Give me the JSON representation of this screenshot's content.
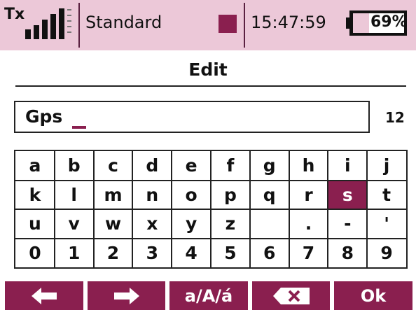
{
  "status_bar": {
    "tx_label": "Tx",
    "signal_icon": "signal-bars-icon",
    "model_name": "Standard",
    "record_indicator_color": "#8a1f4f",
    "clock": "15:47:59",
    "battery_percent": "69%",
    "battery_level": 0.69,
    "background_color": "#ecc8d8"
  },
  "screen": {
    "title": "Edit"
  },
  "text_input": {
    "value": "Gps",
    "remaining_chars": "12"
  },
  "keyboard": {
    "rows": [
      [
        "a",
        "b",
        "c",
        "d",
        "e",
        "f",
        "g",
        "h",
        "i",
        "j"
      ],
      [
        "k",
        "l",
        "m",
        "n",
        "o",
        "p",
        "q",
        "r",
        "s",
        "t"
      ],
      [
        "u",
        "v",
        "w",
        "x",
        "y",
        "z",
        " ",
        ".",
        "-",
        "'"
      ],
      [
        "0",
        "1",
        "2",
        "3",
        "4",
        "5",
        "6",
        "7",
        "8",
        "9"
      ]
    ],
    "selected_key": "s",
    "accent_color": "#8a1f4f"
  },
  "buttons": {
    "left_icon": "arrow-left-icon",
    "right_icon": "arrow-right-icon",
    "case_label": "a/A/á",
    "backspace_icon": "backspace-icon",
    "ok_label": "Ok"
  }
}
